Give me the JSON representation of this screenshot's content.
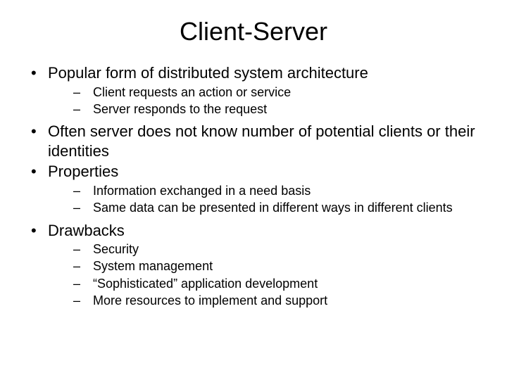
{
  "title": "Client-Server",
  "bullets": {
    "b1": "Popular form of distributed system architecture",
    "b1_sub": {
      "s1": "Client requests an action or service",
      "s2": "Server responds to the request"
    },
    "b2": "Often server does not know number of potential clients or their identities",
    "b3": "Properties",
    "b3_sub": {
      "s1": "Information exchanged in a need basis",
      "s2": "Same data can be presented in different ways in different clients"
    },
    "b4": "Drawbacks",
    "b4_sub": {
      "s1": "Security",
      "s2": "System management",
      "s3": "“Sophisticated” application development",
      "s4": "More resources to implement and support"
    }
  }
}
